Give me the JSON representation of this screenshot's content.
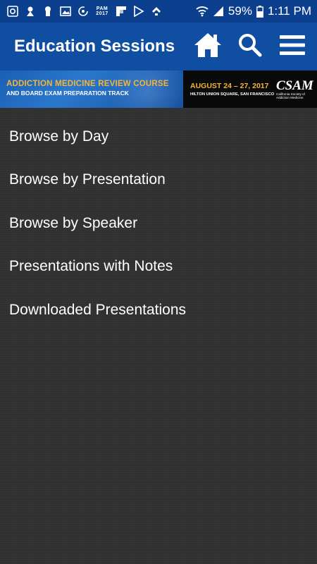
{
  "status_bar": {
    "notification_icons": [
      "pocket-casts-icon",
      "person-icon",
      "keyhole-icon",
      "image-icon",
      "sync-icon",
      "pam-2017-icon",
      "flipboard-icon",
      "play-store-icon",
      "feedly-icon"
    ],
    "pam_label_line1": "PAM",
    "pam_label_line2": "2017",
    "battery_percent": "59%",
    "time": "1:11 PM"
  },
  "app_bar": {
    "title": "Education Sessions",
    "color": "#0f4ea1"
  },
  "banner": {
    "course_title": "ADDICTION MEDICINE REVIEW COURSE",
    "course_subtitle": "AND BOARD EXAM PREPARATION TRACK",
    "dates": "AUGUST 24 – 27, 2017",
    "venue": "HILTON UNION SQUARE, SAN FRANCISCO",
    "logo_mark": "CSAM",
    "logo_sub_line1": "California Society of",
    "logo_sub_line2": "Addiction Medicine",
    "accent": "#f4b53a"
  },
  "menu": {
    "items": [
      {
        "label": "Browse by Day"
      },
      {
        "label": "Browse by Presentation"
      },
      {
        "label": "Browse by Speaker"
      },
      {
        "label": "Presentations with Notes"
      },
      {
        "label": "Downloaded Presentations"
      }
    ]
  }
}
